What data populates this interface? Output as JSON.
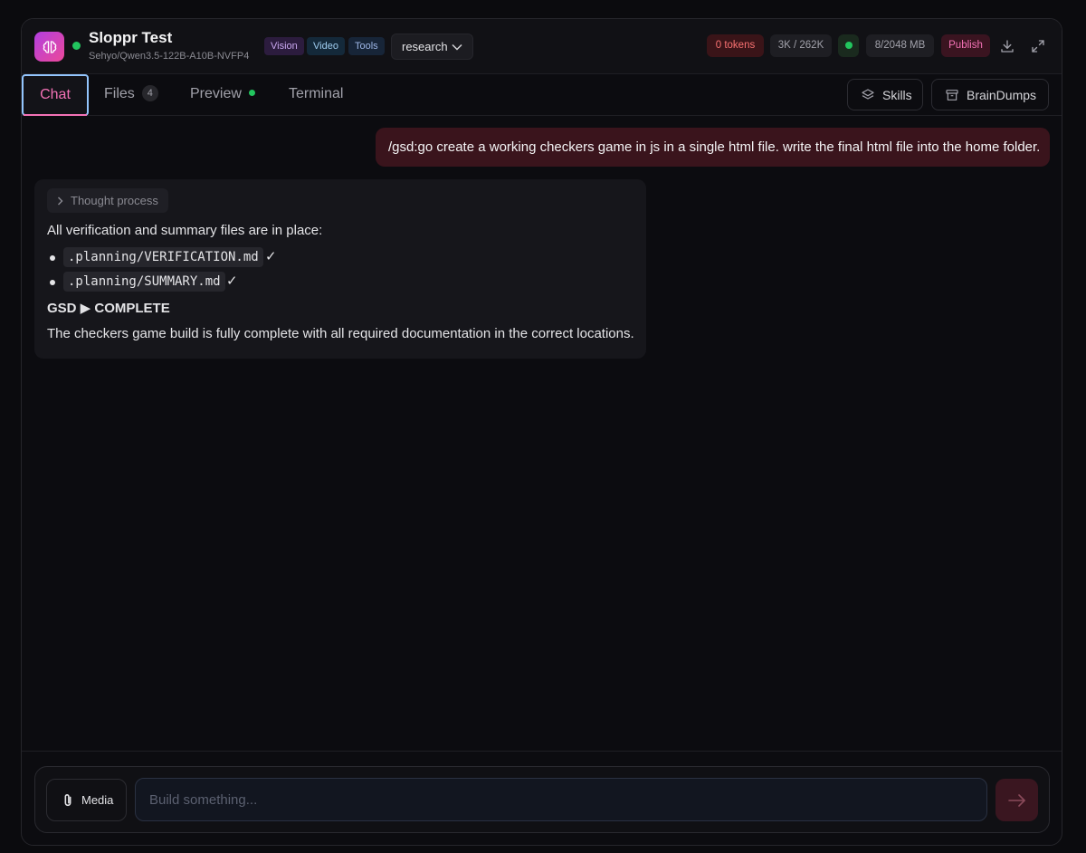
{
  "app": {
    "title": "Sloppr Test",
    "model": "Sehyo/Qwen3.5-122B-A10B-NVFP4",
    "capabilities": [
      "Vision",
      "Video",
      "Tools"
    ],
    "mode": "research"
  },
  "stats": {
    "tokens": "0 tokens",
    "context": "3K / 262K",
    "memory": "8/2048 MB",
    "publish_label": "Publish"
  },
  "tabs": {
    "chat": "Chat",
    "files": "Files",
    "files_count": "4",
    "preview": "Preview",
    "terminal": "Terminal",
    "skills": "Skills",
    "braindumps": "BrainDumps"
  },
  "conversation": {
    "user_message": "/gsd:go create a working checkers game in js in a single html file. write the final html file into the home folder.",
    "thought_label": "Thought process",
    "intro": "All verification and summary files are in place:",
    "files": [
      ".planning/VERIFICATION.md",
      ".planning/SUMMARY.md"
    ],
    "check_mark": "✓",
    "status_heading": "GSD ▶ COMPLETE",
    "final_text": "The checkers game build is fully complete with all required documentation in the correct locations."
  },
  "composer": {
    "media_label": "Media",
    "placeholder": "Build something..."
  },
  "colors": {
    "accent": "#f472b6",
    "online": "#22c55e",
    "tokens_red": "#f87171"
  }
}
